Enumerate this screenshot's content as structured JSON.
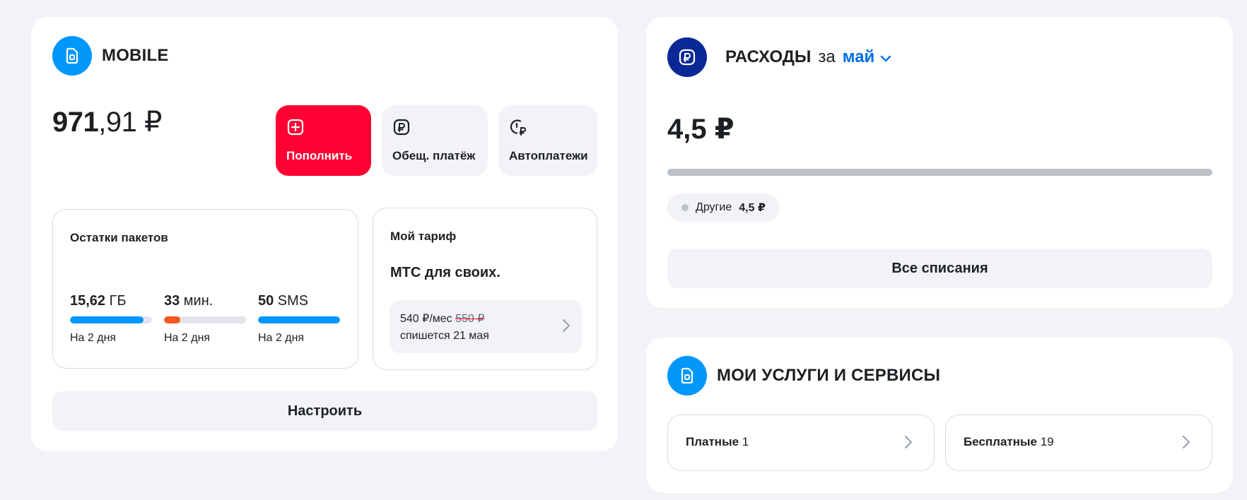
{
  "mobile": {
    "title": "MOBILE",
    "balance_int": "971",
    "balance_frac": ",91 ₽",
    "actions": {
      "topup": "Пополнить",
      "promised": "Обещ. платёж",
      "autopay": "Автоплатежи"
    },
    "packages": {
      "title": "Остатки пакетов",
      "items": [
        {
          "num": "15,62",
          "unit": " ГБ",
          "expires": "На 2 дня",
          "fill": 0.9,
          "color": "#0097fd"
        },
        {
          "num": "33",
          "unit": " мин.",
          "expires": "На 2 дня",
          "fill": 0.2,
          "color": "#f95721"
        },
        {
          "num": "50",
          "unit": " SMS",
          "expires": "На 2 дня",
          "fill": 1.0,
          "color": "#0097fd"
        }
      ]
    },
    "tariff": {
      "title": "Мой тариф",
      "name": "МТС для своих.",
      "price": "540 ₽/мес ",
      "old_price": "550 ₽",
      "debit": "спишется 21 мая"
    },
    "configure": "Настроить"
  },
  "expenses": {
    "title": "РАСХОДЫ",
    "for": "за",
    "month": "май",
    "amount": "4,5 ₽",
    "chip_label": "Другие",
    "chip_amount": "4,5 ₽",
    "all_debits": "Все списания"
  },
  "services": {
    "title": "МОИ УСЛУГИ И СЕРВИСЫ",
    "paid_label": "Платные",
    "paid_count": "1",
    "free_label": "Бесплатные",
    "free_count": "19"
  },
  "colors": {
    "brand_red": "#ff0032",
    "accent_blue": "#0097fd",
    "navy": "#0a2896",
    "link_blue": "#0070e5"
  }
}
